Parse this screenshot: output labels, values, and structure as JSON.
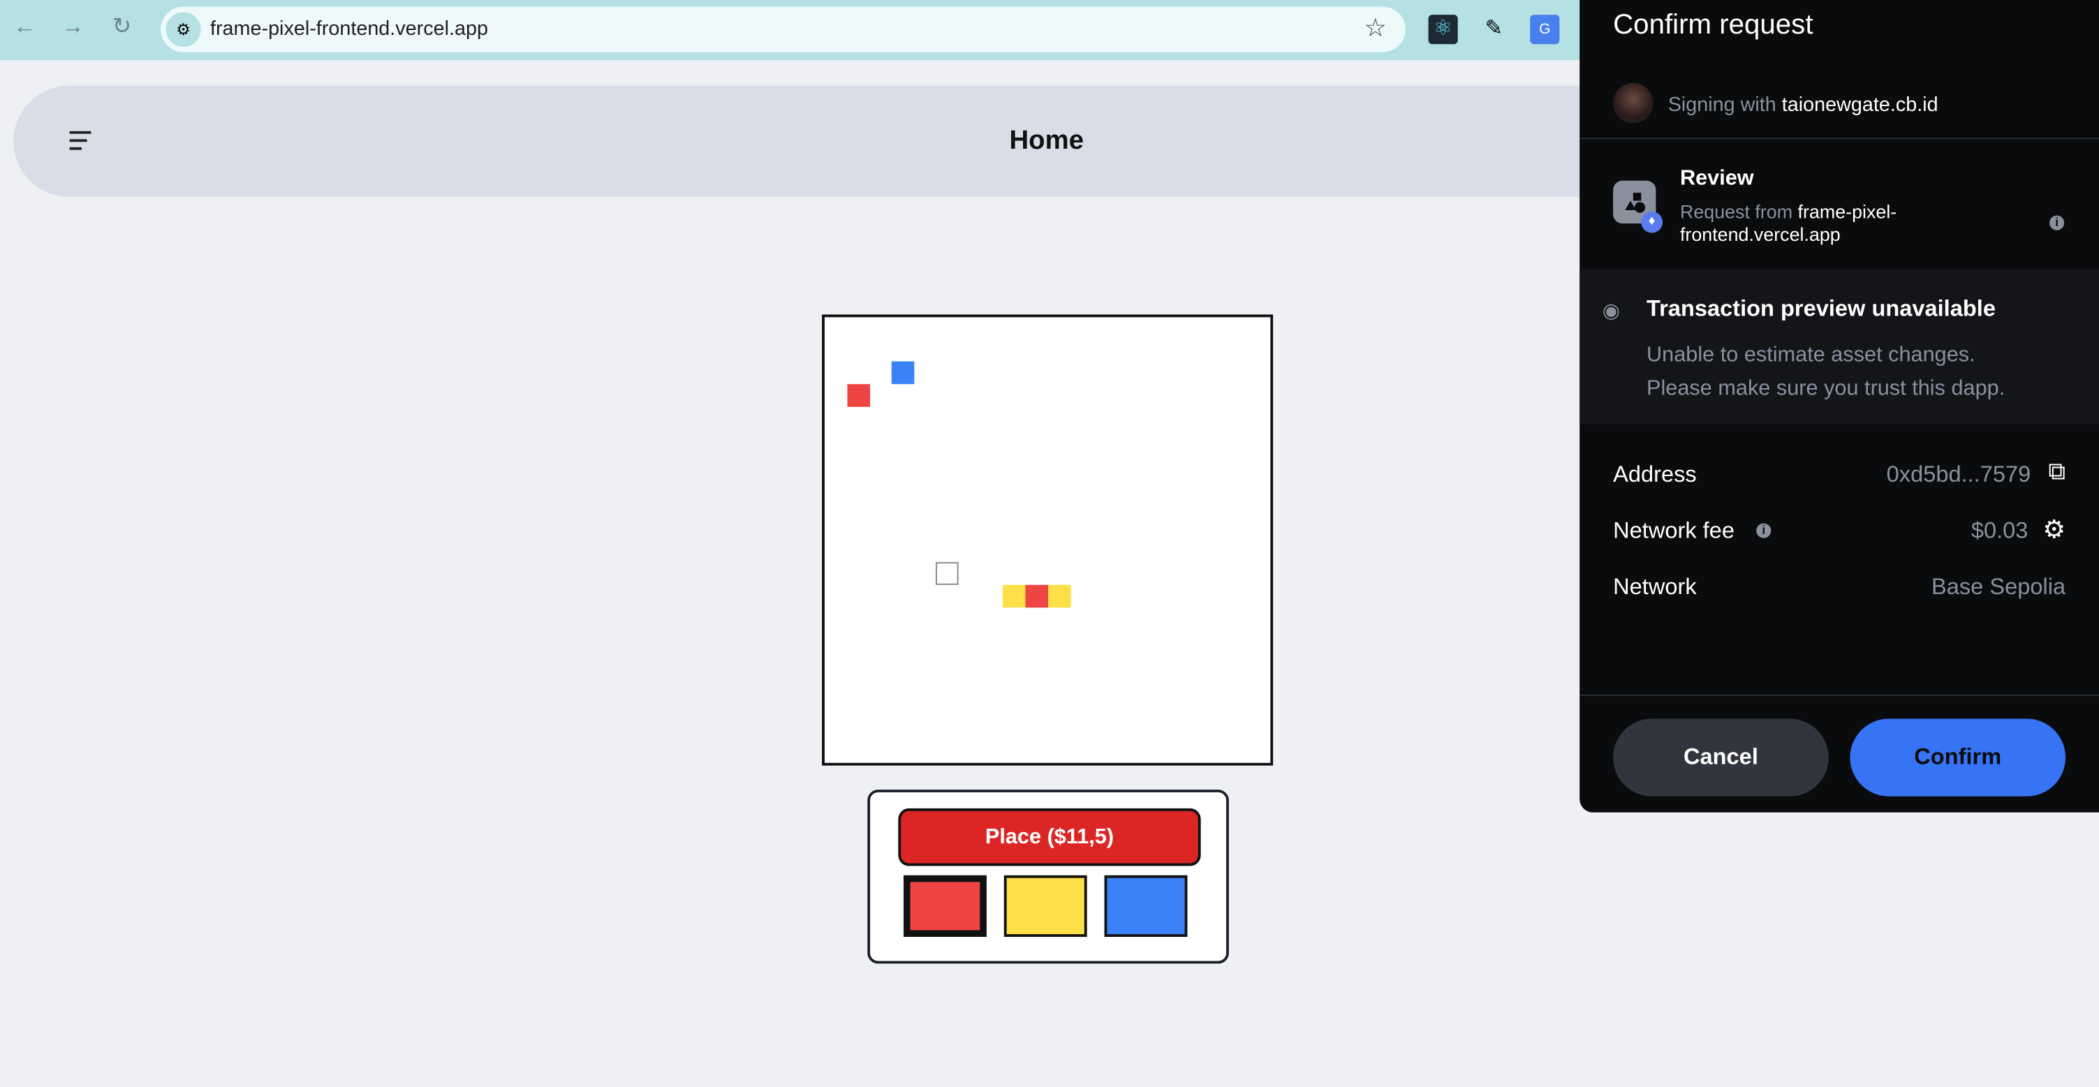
{
  "browser": {
    "url": "frame-pixel-frontend.vercel.app"
  },
  "header": {
    "title": "Home"
  },
  "canvas": {
    "grid_size": 20,
    "pixels": [
      {
        "col": 1,
        "row": 3,
        "color": "#ef4444"
      },
      {
        "col": 3,
        "row": 2,
        "color": "#3b82f6"
      },
      {
        "col": 8,
        "row": 12,
        "color": "#fde047"
      },
      {
        "col": 9,
        "row": 12,
        "color": "#ef4444"
      },
      {
        "col": 10,
        "row": 12,
        "color": "#fde047"
      }
    ],
    "hover": {
      "col": 5,
      "row": 11
    }
  },
  "controls": {
    "place_label": "Place ($11,5)",
    "swatches": [
      {
        "name": "red",
        "color": "#ef4444",
        "selected": true
      },
      {
        "name": "yellow",
        "color": "#fde047",
        "selected": false
      },
      {
        "name": "blue",
        "color": "#3b82f6",
        "selected": false
      }
    ]
  },
  "wallet": {
    "title": "Confirm request",
    "signing_prefix": "Signing with",
    "signing_account": "taionewgate.cb.id",
    "review_title": "Review",
    "request_prefix": "Request from",
    "request_origin": "frame-pixel-frontend.vercel.app",
    "preview_title": "Transaction preview unavailable",
    "preview_line1": "Unable to estimate asset changes.",
    "preview_line2": "Please make sure you trust this dapp.",
    "address_label": "Address",
    "address_value": "0xd5bd...7579",
    "fee_label": "Network fee",
    "fee_value": "$0.03",
    "network_label": "Network",
    "network_value": "Base Sepolia",
    "cancel": "Cancel",
    "confirm": "Confirm",
    "accent": "#3773f5"
  }
}
